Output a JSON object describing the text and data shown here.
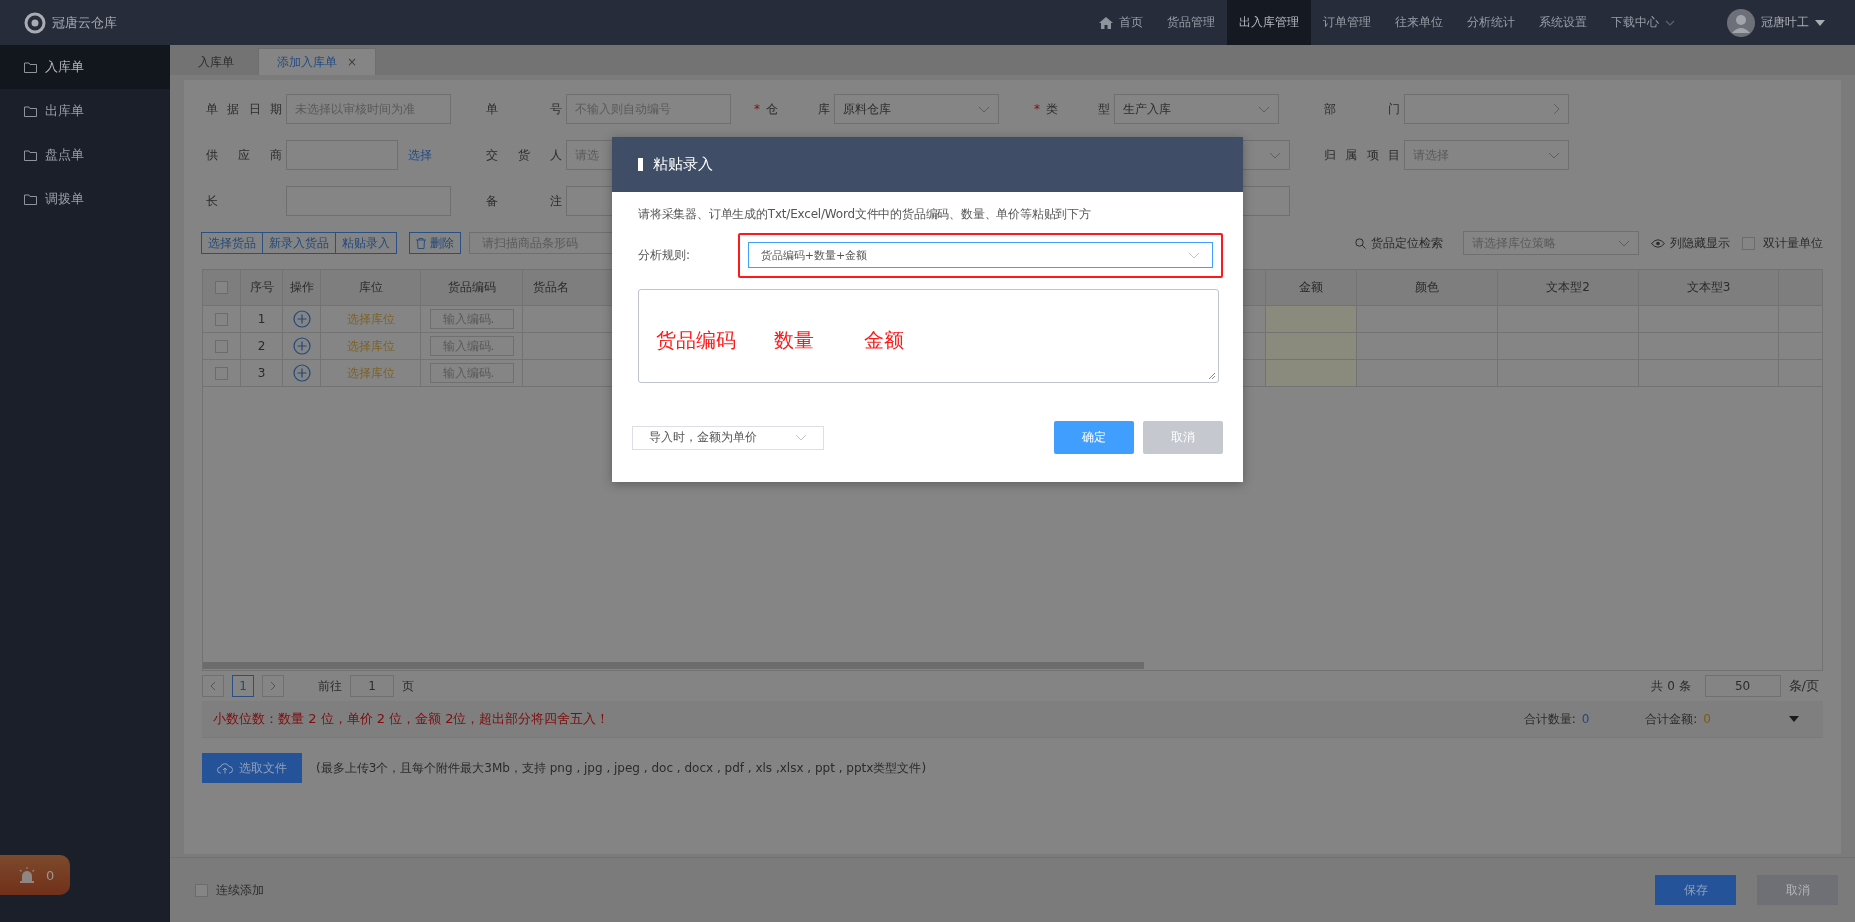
{
  "brand": "冠唐云仓库",
  "nav": [
    {
      "label": "首页",
      "kind": "home",
      "selected": false
    },
    {
      "label": "货品管理",
      "kind": "plain",
      "selected": false
    },
    {
      "label": "出入库管理",
      "kind": "plain",
      "selected": true
    },
    {
      "label": "订单管理",
      "kind": "plain",
      "selected": false
    },
    {
      "label": "往来单位",
      "kind": "plain",
      "selected": false
    },
    {
      "label": "分析统计",
      "kind": "plain",
      "selected": false
    },
    {
      "label": "系统设置",
      "kind": "plain",
      "selected": false
    },
    {
      "label": "下载中心",
      "kind": "dropdown",
      "selected": false
    }
  ],
  "user": "冠唐叶工",
  "sidebar": [
    {
      "label": "入库单",
      "selected": true
    },
    {
      "label": "出库单",
      "selected": false
    },
    {
      "label": "盘点单",
      "selected": false
    },
    {
      "label": "调拨单",
      "selected": false
    }
  ],
  "alert_count": "0",
  "tabs": [
    {
      "label": "入库单",
      "selected": false
    },
    {
      "label": "添加入库单",
      "close": "×",
      "selected": true
    }
  ],
  "form_rows": [
    [
      {
        "label": "单据日期",
        "kind": "input",
        "placeholder": "未选择以审核时间为准"
      },
      {
        "label": "单号",
        "kind": "input",
        "placeholder": "不输入则自动编号"
      },
      {
        "label": "仓库",
        "required_mark": "*",
        "kind": "select",
        "value": "原料仓库"
      },
      {
        "label": "类型",
        "required_mark": "*",
        "kind": "select",
        "value": "生产入库"
      },
      {
        "label": "部门",
        "kind": "picker"
      }
    ],
    [
      {
        "label": "供应商",
        "kind": "input",
        "link": "选择"
      },
      {
        "label": "交货人",
        "kind": "wide-select",
        "placeholder": "请选"
      },
      {
        "label": "归属项目",
        "kind": "select",
        "placeholder": "请选择"
      }
    ],
    [
      {
        "label": "长",
        "kind": "input"
      },
      {
        "label": "备注",
        "kind": "wide-input"
      }
    ]
  ],
  "toolbar": {
    "group_buttons": [
      "选择货品",
      "新录入货品",
      "粘贴录入"
    ],
    "delete": "删除",
    "scan_placeholder": "请扫描商品条形码",
    "locate": "货品定位检索",
    "strategy_placeholder": "请选择库位策略",
    "toggle_columns": "列隐藏显示",
    "dual_unit": {
      "label": "双计量单位",
      "checked": false
    }
  },
  "table": {
    "select_all": false,
    "columns": [
      "序号",
      "操作",
      "库位",
      "货品编码",
      "货品名",
      "金额",
      "颜色",
      "文本型2",
      "文本型3"
    ],
    "rows": [
      {
        "index": "1",
        "location": "选择库位",
        "code_placeholder": "输入编码.",
        "checked": false
      },
      {
        "index": "2",
        "location": "选择库位",
        "code_placeholder": "输入编码.",
        "checked": false
      },
      {
        "index": "3",
        "location": "选择库位",
        "code_placeholder": "输入编码.",
        "checked": false
      }
    ]
  },
  "pagination": {
    "current": "1",
    "goto_label": "前往",
    "goto_value": "1",
    "page_unit": "页",
    "total": "共 0 条",
    "page_size": "50",
    "size_unit": "条/页"
  },
  "decimal_note": "小数位数：数量 2 位，单价 2 位，金额 2位，超出部分将四舍五入！",
  "totals": [
    {
      "label": "合计数量:",
      "value": "0",
      "kind": "quantity"
    },
    {
      "label": "合计金额:",
      "value": "0",
      "kind": "amount"
    }
  ],
  "upload": {
    "button": "选取文件",
    "hint": "(最多上传3个，且每个附件最大3Mb，支持 png , jpg , jpeg , doc , docx , pdf , xls ,xlsx , ppt , pptx类型文件)"
  },
  "footer": {
    "continue_add": {
      "label": "连续添加",
      "checked": false
    },
    "save": "保存",
    "cancel": "取消"
  },
  "dialog": {
    "title": "粘贴录入",
    "instruction": "请将采集器、订单生成的Txt/Excel/Word文件中的货品编码、数量、单价等粘贴到下方",
    "rule_label": "分析规则:",
    "rule_value": "货品编码+数量+金额",
    "pasted_words": [
      "货品编码",
      "数量",
      "金额"
    ],
    "import_option": "导入时，金额为单价",
    "confirm": "确定",
    "cancel": "取消"
  }
}
